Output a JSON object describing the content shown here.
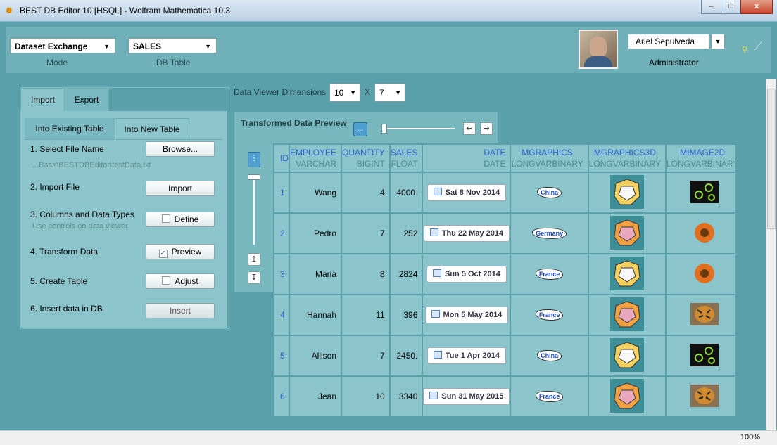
{
  "window": {
    "title": "BEST DB Editor 10 [HSQL] - Wolfram Mathematica 10.3",
    "minimize": "–",
    "maximize": "□",
    "close": "x"
  },
  "header": {
    "mode_value": "Dataset Exchange",
    "mode_label": "Mode",
    "table_value": "SALES",
    "table_label": "DB Table",
    "user_name": "Ariel Sepulveda",
    "user_role": "Administrator"
  },
  "left_panel": {
    "tabs": [
      "Import",
      "Export"
    ],
    "subtabs": [
      "Into Existing Table",
      "Into New Table"
    ],
    "steps": [
      {
        "label": "1.  Select File Name",
        "button": "Browse...",
        "sub": "...Base\\BESTDBEditor\\testData.txt"
      },
      {
        "label": "2.  Import File",
        "button": "Import"
      },
      {
        "label": "3.  Columns and Data Types",
        "button": "Define",
        "sub": "Use controls on data viewer.",
        "checked": false
      },
      {
        "label": "4.  Transform Data",
        "button": "Preview",
        "checked": true
      },
      {
        "label": "5.  Create Table",
        "button": "Adjust",
        "checked": false
      },
      {
        "label": "6.  Insert data in DB",
        "button": "Insert"
      }
    ]
  },
  "viewer": {
    "dimensions_label": "Data Viewer Dimensions",
    "rows_value": "10",
    "x_label": "X",
    "cols_value": "7",
    "preview_label": "Transformed Data Preview",
    "more_btn": "...",
    "left_btn": "↤",
    "right_btn": "↦",
    "up_btn": "↥",
    "down_btn": "↧",
    "menu_btn": "⋮"
  },
  "grid": {
    "columns": [
      {
        "name": "ID",
        "type": ""
      },
      {
        "name": "EMPLOYEE",
        "type": "VARCHAR"
      },
      {
        "name": "QUANTITY",
        "type": "BIGINT"
      },
      {
        "name": "SALES",
        "type": "FLOAT"
      },
      {
        "name": "DATE",
        "type": "DATE"
      },
      {
        "name": "MGRAPHICS",
        "type": "LONGVARBINARY"
      },
      {
        "name": "MGRAPHICS3D",
        "type": "LONGVARBINARY"
      },
      {
        "name": "MIMAGE2D",
        "type": "LONGVARBINARY"
      }
    ],
    "rows": [
      {
        "id": "1",
        "employee": "Wang",
        "quantity": "4",
        "sales": "4000.",
        "date": "Sat 8 Nov 2014",
        "map": "China",
        "img": "cells"
      },
      {
        "id": "2",
        "employee": "Pedro",
        "quantity": "7",
        "sales": "252",
        "date": "Thu 22 May 2014",
        "map": "Germany",
        "img": "flower"
      },
      {
        "id": "3",
        "employee": "Maria",
        "quantity": "8",
        "sales": "2824",
        "date": "Sun 5 Oct 2014",
        "map": "France",
        "img": "flower"
      },
      {
        "id": "4",
        "employee": "Hannah",
        "quantity": "11",
        "sales": "396",
        "date": "Mon 5 May 2014",
        "map": "France",
        "img": "tiger"
      },
      {
        "id": "5",
        "employee": "Allison",
        "quantity": "7",
        "sales": "2450.",
        "date": "Tue 1 Apr 2014",
        "map": "China",
        "img": "cells"
      },
      {
        "id": "6",
        "employee": "Jean",
        "quantity": "10",
        "sales": "3340",
        "date": "Sun 31 May 2015",
        "map": "France",
        "img": "tiger"
      }
    ]
  },
  "status": {
    "zoom": "100%"
  }
}
